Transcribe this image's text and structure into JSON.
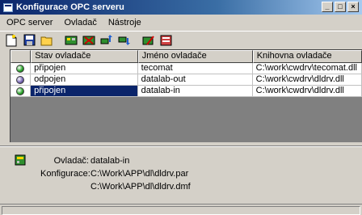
{
  "window": {
    "title": "Konfigurace OPC serveru"
  },
  "menu": [
    {
      "id": "opc-server",
      "label": "OPC server"
    },
    {
      "id": "ovladac",
      "label": "Ovladač"
    },
    {
      "id": "nastroje",
      "label": "Nástroje"
    }
  ],
  "toolbar": {
    "buttons": [
      "new-file-icon",
      "save-icon",
      "open-folder-icon",
      "driver-icon",
      "driver-remove-icon",
      "move-up-icon",
      "move-down-icon",
      "edit-icon",
      "properties-icon"
    ]
  },
  "table": {
    "columns": [
      "Stav ovladače",
      "Jméno ovladače",
      "Knihovna ovladače"
    ],
    "rows": [
      {
        "status_color": "#2fa82f",
        "status": "připojen",
        "name": "tecomat",
        "library": "C:\\work\\cwdrv\\tecomat.dll",
        "selected": false
      },
      {
        "status_color": "#7a6ab8",
        "status": "odpojen",
        "name": "datalab-out",
        "library": "C:\\work\\cwdrv\\dldrv.dll",
        "selected": false
      },
      {
        "status_color": "#2fa82f",
        "status": "připojen",
        "name": "datalab-in",
        "library": "C:\\work\\cwdrv\\dldrv.dll",
        "selected": true
      }
    ]
  },
  "details": {
    "driver_label": "Ovladač:",
    "driver_value": "datalab-in",
    "config_label": "Konfigurace:",
    "config_value_1": "C:\\Work\\APP\\dl\\dldrv.par",
    "config_value_2": "C:\\Work\\APP\\dl\\dldrv.dmf"
  },
  "colors": {
    "selection": "#0a246a",
    "title_start": "#0a246a",
    "title_end": "#a6caf0"
  }
}
